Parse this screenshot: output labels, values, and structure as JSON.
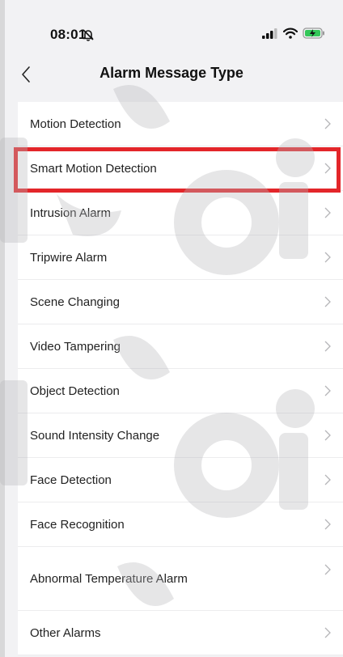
{
  "status": {
    "time": "08:01"
  },
  "nav": {
    "title": "Alarm Message Type"
  },
  "items": [
    {
      "label": "Motion Detection"
    },
    {
      "label": "Smart Motion Detection"
    },
    {
      "label": "Intrusion Alarm"
    },
    {
      "label": "Tripwire Alarm"
    },
    {
      "label": "Scene Changing"
    },
    {
      "label": "Video Tampering"
    },
    {
      "label": "Object Detection"
    },
    {
      "label": "Sound Intensity Change"
    },
    {
      "label": "Face Detection"
    },
    {
      "label": "Face Recognition"
    },
    {
      "label": "Abnormal Temperature Alarm"
    },
    {
      "label": "Other Alarms"
    }
  ],
  "colors": {
    "highlight": "#e3262a",
    "background": "#f2f2f4"
  },
  "icons": {
    "back": "chevron-left-icon",
    "row": "chevron-right-icon",
    "mute": "bell-slash-icon"
  }
}
